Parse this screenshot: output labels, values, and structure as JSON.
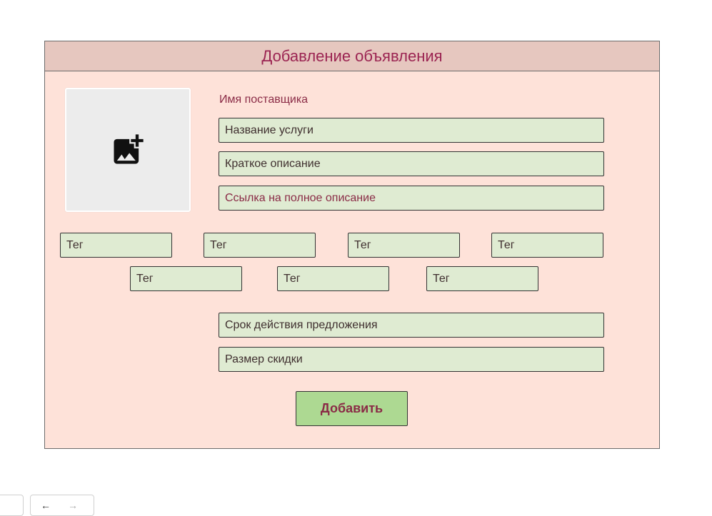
{
  "header": {
    "title": "Добавление объявления"
  },
  "image_upload": {
    "icon": "add-photo-icon"
  },
  "supplier": {
    "label": "Имя поставщика"
  },
  "fields": {
    "service_name": "Название услуги",
    "short_description": "Краткое описание",
    "full_description_link": "Ссылка на полное описание",
    "offer_validity": "Срок действия предложения",
    "discount_size": "Размер скидки"
  },
  "tags": [
    "Тег",
    "Тег",
    "Тег",
    "Тег",
    "Тег",
    "Тег",
    "Тег"
  ],
  "actions": {
    "submit_label": "Добавить"
  },
  "browser_nav": {
    "back_icon": "←",
    "forward_icon": "→"
  },
  "colors": {
    "panel_bg": "#fee2d9",
    "header_bg": "#e6c7bf",
    "accent_text": "#9b2452",
    "field_bg": "#dfebd2",
    "button_bg": "#add992"
  }
}
